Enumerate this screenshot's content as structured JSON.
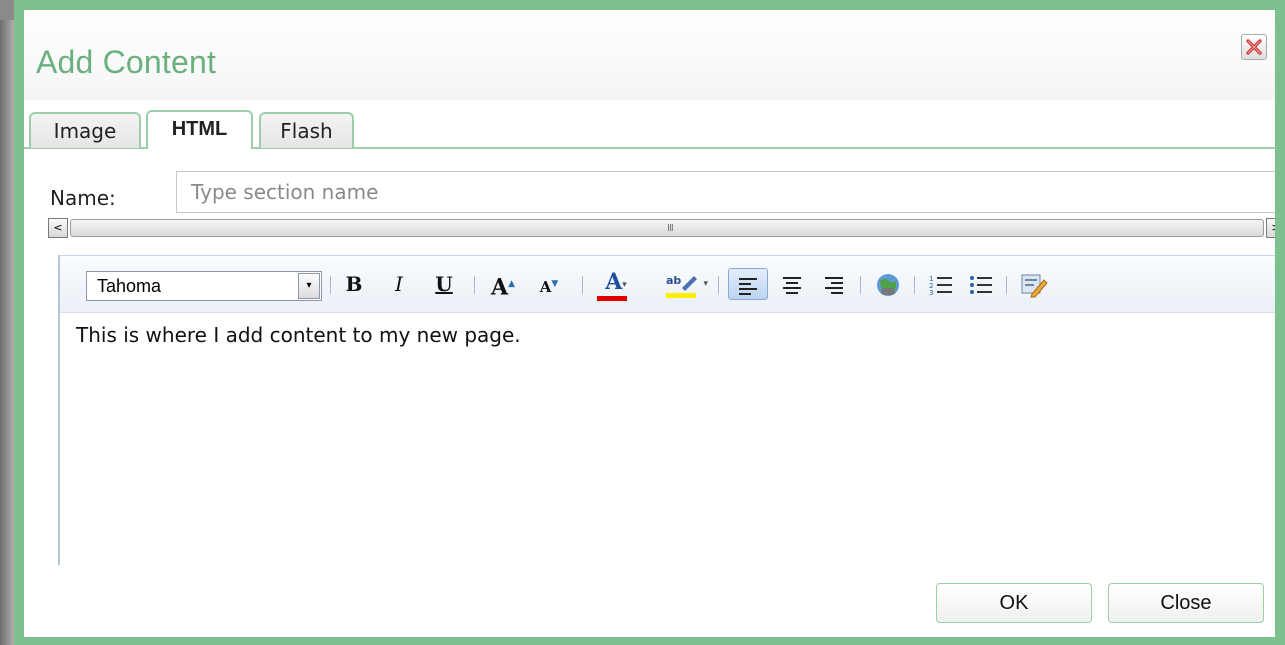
{
  "dialog": {
    "title": "Add Content"
  },
  "tabs": [
    {
      "label": "Image",
      "active": false
    },
    {
      "label": "HTML",
      "active": true
    },
    {
      "label": "Flash",
      "active": false
    }
  ],
  "form": {
    "name_label": "Name:",
    "name_placeholder": "Type section name",
    "name_value": ""
  },
  "scrollbar": {
    "left_arrow": "<",
    "right_arrow": ">",
    "grip": "III"
  },
  "toolbar": {
    "font": "Tahoma",
    "bold": "B",
    "italic": "I",
    "underline": "U",
    "grow_font": "A",
    "shrink_font": "A",
    "font_color": "A",
    "font_color_swatch": "#e00000",
    "highlight_swatch": "#ffee00",
    "alignment": "left"
  },
  "editor": {
    "content": "This is where I add content to my new page."
  },
  "buttons": {
    "ok": "OK",
    "close": "Close"
  },
  "colors": {
    "accent": "#7cc08e",
    "title": "#6bb07f"
  }
}
